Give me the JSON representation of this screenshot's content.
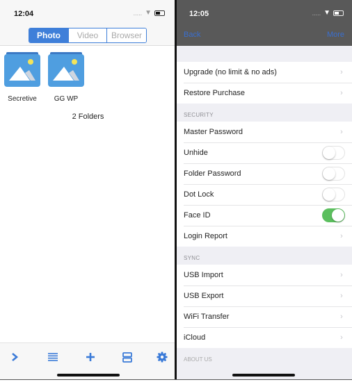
{
  "left_screen": {
    "status_time": "12:04",
    "signal": ".....",
    "segments": [
      {
        "label": "Photo",
        "active": true
      },
      {
        "label": "Video",
        "active": false
      },
      {
        "label": "Browser",
        "active": false
      }
    ],
    "folders": [
      {
        "name": "Secretive",
        "icon": "image-folder-icon"
      },
      {
        "name": "GG WP",
        "icon": "image-folder-icon"
      }
    ],
    "folder_count": "2 Folders",
    "toolbar": [
      {
        "name": "chevron-right-icon",
        "glyph": "chevron"
      },
      {
        "name": "list-icon",
        "glyph": "list"
      },
      {
        "name": "add-icon",
        "glyph": "plus"
      },
      {
        "name": "grid-view-icon",
        "glyph": "rows"
      },
      {
        "name": "settings-gear-icon",
        "glyph": "gear"
      }
    ]
  },
  "right_screen": {
    "status_time": "12:05",
    "signal": ".....",
    "nav": {
      "back_label": "Back",
      "more_label": "More"
    },
    "purchase": [
      {
        "label": "Upgrade (no limit & no ads)",
        "type": "chevron"
      },
      {
        "label": "Restore Purchase",
        "type": "chevron"
      }
    ],
    "security_header": "SECURITY",
    "security": [
      {
        "label": "Master Password",
        "type": "chevron"
      },
      {
        "label": "Unhide",
        "type": "toggle",
        "on": false
      },
      {
        "label": "Folder Password",
        "type": "toggle",
        "on": false
      },
      {
        "label": "Dot Lock",
        "type": "toggle",
        "on": false
      },
      {
        "label": "Face ID",
        "type": "toggle",
        "on": true
      },
      {
        "label": "Login Report",
        "type": "chevron"
      }
    ],
    "sync_header": "SYNC",
    "sync": [
      {
        "label": "USB Import",
        "type": "chevron"
      },
      {
        "label": "USB Export",
        "type": "chevron"
      },
      {
        "label": "WiFi Transfer",
        "type": "chevron"
      },
      {
        "label": "iCloud",
        "type": "chevron"
      }
    ],
    "about_header": "ABOUT US"
  },
  "colors": {
    "accent": "#3f7fd9",
    "toggle_on": "#5bbf5e",
    "nav_bar": "#595959"
  }
}
